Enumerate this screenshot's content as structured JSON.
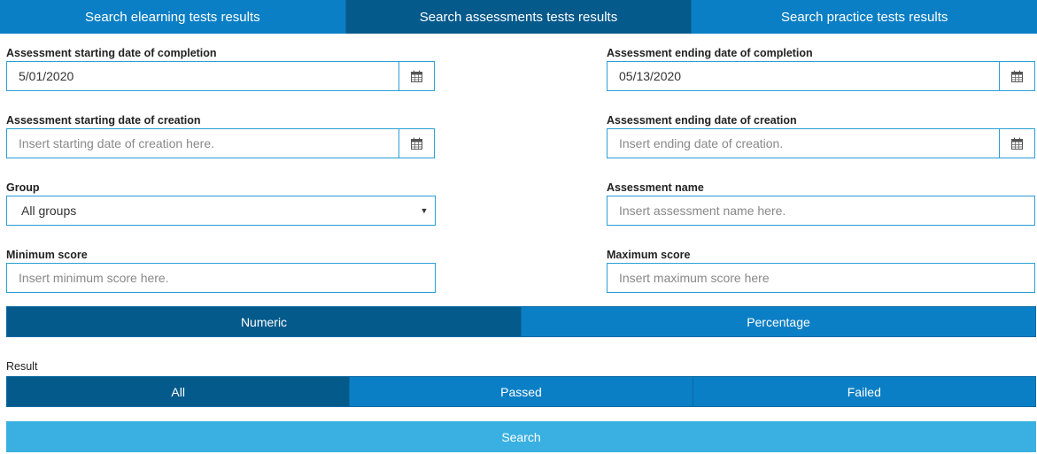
{
  "tabs": [
    {
      "label": "Search elearning tests results",
      "active": false
    },
    {
      "label": "Search assessments tests results",
      "active": true
    },
    {
      "label": "Search practice tests results",
      "active": false
    }
  ],
  "fields": {
    "start_completion": {
      "label": "Assessment starting date of completion",
      "value": "5/01/2020",
      "placeholder": ""
    },
    "end_completion": {
      "label": "Assessment ending date of completion",
      "value": "05/13/2020",
      "placeholder": ""
    },
    "start_creation": {
      "label": "Assessment starting date of creation",
      "value": "",
      "placeholder": "Insert starting date of creation here."
    },
    "end_creation": {
      "label": "Assessment ending date of creation",
      "value": "",
      "placeholder": "Insert ending date of creation."
    },
    "group": {
      "label": "Group",
      "selected": "All groups"
    },
    "assessment_name": {
      "label": "Assessment name",
      "value": "",
      "placeholder": "Insert assessment name here."
    },
    "min_score": {
      "label": "Minimum score",
      "value": "",
      "placeholder": "Insert minimum score here."
    },
    "max_score": {
      "label": "Maximum score",
      "value": "",
      "placeholder": "Insert maximum score here"
    }
  },
  "score_type": {
    "options": [
      {
        "label": "Numeric",
        "active": true
      },
      {
        "label": "Percentage",
        "active": false
      }
    ]
  },
  "result": {
    "label": "Result",
    "options": [
      {
        "label": "All",
        "active": true
      },
      {
        "label": "Passed",
        "active": false
      },
      {
        "label": "Failed",
        "active": false
      }
    ]
  },
  "search_button": {
    "label": "Search"
  },
  "colors": {
    "tab_bg": "#0b7fc5",
    "tab_active_bg": "#055a8c",
    "input_border": "#2a9fd6",
    "search_bg": "#3ab0e2"
  },
  "icons": {
    "calendar": "calendar-icon",
    "dropdown": "caret-down-icon"
  }
}
